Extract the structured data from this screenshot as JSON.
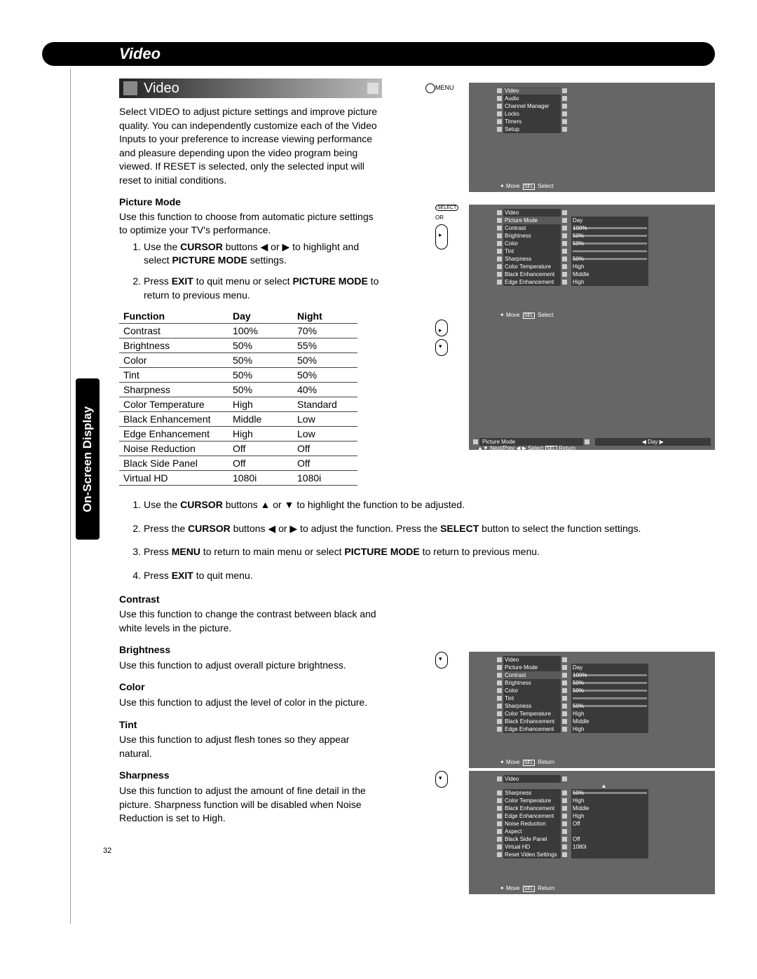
{
  "header": {
    "title": "Video",
    "subtitle": "Video"
  },
  "sidebar": {
    "label": "On-Screen Display"
  },
  "intro": "Select VIDEO to adjust picture settings and improve picture quality. You can independently customize each of the Video Inputs to your preference to increase viewing performance and pleasure depending upon the video program being viewed. If RESET is selected, only the selected input will reset to initial conditions.",
  "picture_mode": {
    "heading": "Picture Mode",
    "desc": "Use this function to choose from automatic picture settings to optimize your TV's performance.",
    "step1a": "Use the ",
    "step1b": "CURSOR",
    "step1c": " buttons ◀ or ▶ to highlight and select ",
    "step1d": "PICTURE MODE",
    "step1e": " settings.",
    "step2a": "Press ",
    "step2b": "EXIT",
    "step2c": " to quit menu or select ",
    "step2d": "PICTURE MODE",
    "step2e": " to return to previous menu."
  },
  "table": {
    "h1": "Function",
    "h2": "Day",
    "h3": "Night",
    "rows": [
      {
        "f": "Contrast",
        "d": "100%",
        "n": "70%"
      },
      {
        "f": "Brightness",
        "d": "50%",
        "n": "55%"
      },
      {
        "f": "Color",
        "d": "50%",
        "n": "50%"
      },
      {
        "f": "Tint",
        "d": "50%",
        "n": "50%"
      },
      {
        "f": "Sharpness",
        "d": "50%",
        "n": "40%"
      },
      {
        "f": "Color Temperature",
        "d": "High",
        "n": "Standard"
      },
      {
        "f": "Black Enhancement",
        "d": "Middle",
        "n": "Low"
      },
      {
        "f": "Edge Enhancement",
        "d": "High",
        "n": "Low"
      },
      {
        "f": "Noise Reduction",
        "d": "Off",
        "n": "Off"
      },
      {
        "f": "Black Side Panel",
        "d": "Off",
        "n": "Off"
      },
      {
        "f": "Virtual HD",
        "d": "1080i",
        "n": "1080i"
      }
    ]
  },
  "steps": {
    "s1a": "Use the ",
    "s1b": "CURSOR",
    "s1c": " buttons ▲ or ▼ to highlight the function to be adjusted.",
    "s2a": "Press the ",
    "s2b": "CURSOR",
    "s2c": " buttons ◀ or ▶ to adjust the function. Press the ",
    "s2d": "SELECT",
    "s2e": " button to select the function settings.",
    "s3a": "Press ",
    "s3b": "MENU",
    "s3c": " to return to main menu or select ",
    "s3d": "PICTURE MODE",
    "s3e": " to return to previous menu.",
    "s4a": "Press ",
    "s4b": "EXIT",
    "s4c": " to quit menu."
  },
  "defs": {
    "contrast": {
      "h": "Contrast",
      "t": "Use this function to change the contrast between black and white levels in the picture."
    },
    "brightness": {
      "h": "Brightness",
      "t": "Use this function to adjust overall picture brightness."
    },
    "color": {
      "h": "Color",
      "t": "Use this function to adjust the level of color in the picture."
    },
    "tint": {
      "h": "Tint",
      "t": "Use this function to adjust flesh tones so they appear natural."
    },
    "sharpness": {
      "h": "Sharpness",
      "t": "Use this function to adjust the amount of fine detail in the picture. Sharpness function will be disabled when Noise Reduction is set to High."
    }
  },
  "osd1": {
    "label": "MENU",
    "items": [
      "Video",
      "Audio",
      "Channel Manager",
      "Locks",
      "Timers",
      "Setup"
    ],
    "hint_move": "Move",
    "hint_sel": "SEL",
    "hint_select": "Select"
  },
  "osd2": {
    "label_select": "SELECT",
    "label_or": "OR",
    "title": "Video",
    "rows": [
      {
        "n": "Picture Mode",
        "v": "Day"
      },
      {
        "n": "Contrast",
        "v": "100%",
        "slider": true
      },
      {
        "n": "Brightness",
        "v": "50%",
        "slider": true
      },
      {
        "n": "Color",
        "v": "50%",
        "slider": true
      },
      {
        "n": "Tint",
        "v": "",
        "slider": true
      },
      {
        "n": "Sharpness",
        "v": "50%",
        "slider": true
      },
      {
        "n": "Color Temperature",
        "v": "High"
      },
      {
        "n": "Black Enhancement",
        "v": "Middle"
      },
      {
        "n": "Edge Enhancement",
        "v": "High"
      }
    ],
    "hint_move": "Move",
    "hint_sel": "SEL",
    "hint_select": "Select"
  },
  "osd3": {
    "pic": "Picture Mode",
    "day": "◀  Day  ▶",
    "hint": "Next/Prev    ◀ ▶ Select",
    "hint_sel": "SEL",
    "hint_return": "Return"
  },
  "osd4": {
    "title": "Video",
    "rows": [
      {
        "n": "Picture Mode",
        "v": "Day"
      },
      {
        "n": "Contrast",
        "v": "100%",
        "slider": true
      },
      {
        "n": "Brightness",
        "v": "50%",
        "slider": true
      },
      {
        "n": "Color",
        "v": "50%",
        "slider": true
      },
      {
        "n": "Tint",
        "v": "",
        "slider": true
      },
      {
        "n": "Sharpness",
        "v": "50%",
        "slider": true
      },
      {
        "n": "Color Temperature",
        "v": "High"
      },
      {
        "n": "Black Enhancement",
        "v": "Middle"
      },
      {
        "n": "Edge Enhancement",
        "v": "High"
      }
    ],
    "hint_move": "Move",
    "hint_sel": "SEL",
    "hint_return": "Return"
  },
  "osd5": {
    "title": "Video",
    "rows": [
      {
        "n": "Sharpness",
        "v": "50%",
        "slider": true
      },
      {
        "n": "Color Temperature",
        "v": "High"
      },
      {
        "n": "Black Enhancement",
        "v": "Middle"
      },
      {
        "n": "Edge Enhancement",
        "v": "High"
      },
      {
        "n": "Noise Reduction",
        "v": "Off"
      },
      {
        "n": "Aspect",
        "v": ""
      },
      {
        "n": "Black Side Panel",
        "v": "Off"
      },
      {
        "n": "Virtual HD",
        "v": "1080i"
      },
      {
        "n": "Reset Video Settings",
        "v": ""
      }
    ],
    "hint_move": "Move",
    "hint_sel": "SEL",
    "hint_return": "Return"
  },
  "page_number": "32"
}
